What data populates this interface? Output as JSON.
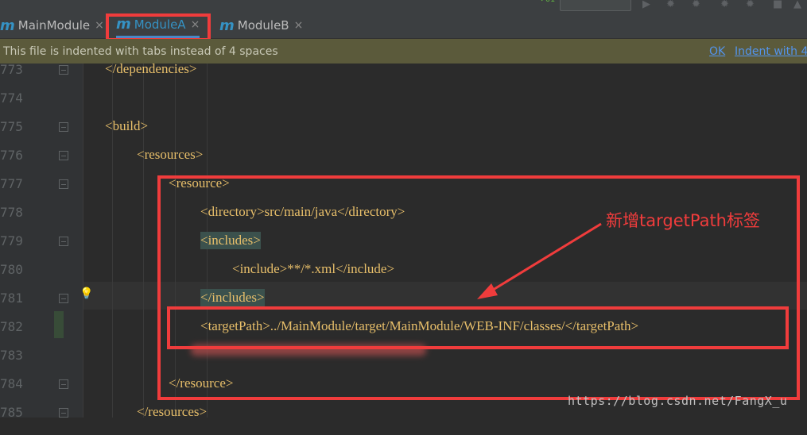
{
  "tabs": [
    {
      "icon": "maven-module-icon",
      "label": "MainModule",
      "active": false
    },
    {
      "icon": "maven-module-icon",
      "label": "ModuleA",
      "active": true
    },
    {
      "icon": "maven-module-icon",
      "label": "ModuleB",
      "active": false
    }
  ],
  "tab_icon_glyph": "m",
  "close_glyph": "×",
  "notification": {
    "message": "This file is indented with tabs instead of 4 spaces",
    "ok_link": "OK",
    "indent_link": "Indent with 4"
  },
  "lines": [
    {
      "number": "773",
      "text": "</dependencies>"
    },
    {
      "number": "774",
      "text": ""
    },
    {
      "number": "775",
      "text": "<build>"
    },
    {
      "number": "776",
      "text": "<resources>"
    },
    {
      "number": "777",
      "text": "<resource>"
    },
    {
      "number": "778",
      "text": "<directory>src/main/java</directory>"
    },
    {
      "number": "779",
      "text": "<includes>"
    },
    {
      "number": "780",
      "text": "<include>**/*.xml</include>"
    },
    {
      "number": "781",
      "text": "</includes>"
    },
    {
      "number": "782",
      "text": "<targetPath>../MainModule/target/MainModule/WEB-INF/classes/</targetPath>"
    },
    {
      "number": "783",
      "text": ""
    },
    {
      "number": "784",
      "text": "</resource>"
    },
    {
      "number": "785",
      "text": "</resources>"
    }
  ],
  "annotation": "新增targetPath标签",
  "watermark": "https://blog.csdn.net/FangX_u",
  "colors": {
    "annotation_red": "#f03c3c",
    "tag_yellow": "#e8bf6a",
    "link_blue": "#5394ec",
    "module_blue": "#3592c4"
  }
}
